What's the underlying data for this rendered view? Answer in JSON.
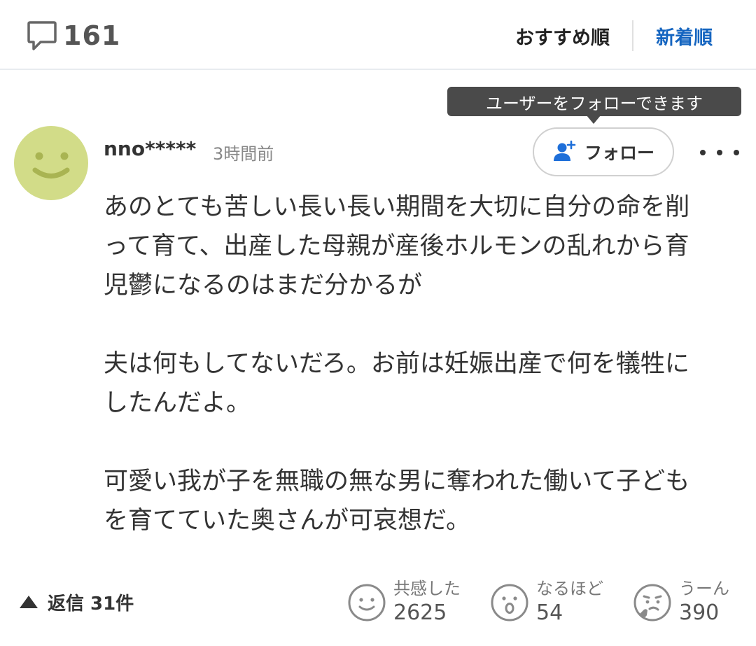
{
  "header": {
    "comment_count": "161",
    "sort_recommended": "おすすめ順",
    "sort_newest": "新着順",
    "active_sort": "新着順"
  },
  "tooltip": {
    "text": "ユーザーをフォローできます"
  },
  "comment": {
    "username": "nno*****",
    "timestamp": "3時間前",
    "follow_label": "フォロー",
    "paragraphs": [
      {
        "lines": [
          "あのとても苦しい長い長い期間を大切に自分の命を削",
          "って育て、出産した母親が産後ホルモンの乱れから育",
          "児鬱になるのはまだ分かるが"
        ]
      },
      {
        "lines": [
          "夫は何もしてないだろ。お前は妊娠出産で何を犠牲に",
          "したんだよ。"
        ]
      },
      {
        "lines": [
          "可愛い我が子を無職の無な男に奪われた働いて子ども",
          "を育てていた奥さんが可哀想だ。"
        ]
      }
    ]
  },
  "footer": {
    "reply_label": "返信 31件",
    "reactions": [
      {
        "label": "共感した",
        "count": "2625",
        "icon": "smile-face-icon"
      },
      {
        "label": "なるほど",
        "count": "54",
        "icon": "surprised-face-icon"
      },
      {
        "label": "うーん",
        "count": "390",
        "icon": "thinking-face-icon"
      }
    ]
  },
  "colors": {
    "accent_blue": "#1565c0",
    "avatar_bg": "#d2dc88",
    "tooltip_bg": "#4a4a4a",
    "follow_icon": "#1e6fd9"
  }
}
